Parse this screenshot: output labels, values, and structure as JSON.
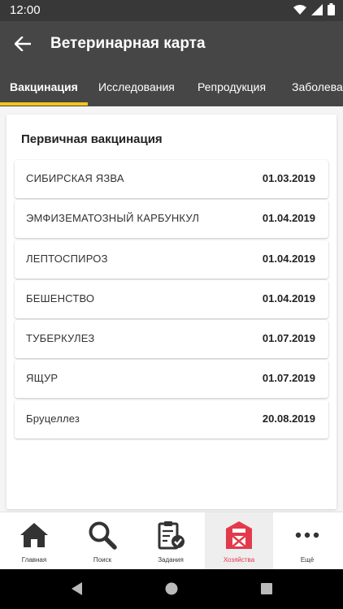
{
  "status_bar": {
    "time": "12:00"
  },
  "app_bar": {
    "title": "Ветеринарная карта"
  },
  "tabs": [
    {
      "label": "Вакцинация",
      "active": true
    },
    {
      "label": "Исследования",
      "active": false
    },
    {
      "label": "Репродукция",
      "active": false
    },
    {
      "label": "Заболева",
      "active": false
    }
  ],
  "section": {
    "title": "Первичная вакцинация",
    "rows": [
      {
        "name": "СИБИРСКАЯ ЯЗВА",
        "date": "01.03.2019"
      },
      {
        "name": "ЭМФИЗЕМАТОЗНЫЙ КАРБУНКУЛ",
        "date": "01.04.2019"
      },
      {
        "name": "ЛЕПТОСПИРОЗ",
        "date": "01.04.2019"
      },
      {
        "name": "БЕШЕНСТВО",
        "date": "01.04.2019"
      },
      {
        "name": "ТУБЕРКУЛЕЗ",
        "date": "01.07.2019"
      },
      {
        "name": "ЯЩУР",
        "date": "01.07.2019"
      },
      {
        "name": "Бруцеллез",
        "date": "20.08.2019"
      }
    ]
  },
  "bottom_nav": [
    {
      "label": "Главная",
      "icon": "home-icon",
      "active": false
    },
    {
      "label": "Поиск",
      "icon": "search-icon",
      "active": false
    },
    {
      "label": "Задания",
      "icon": "tasks-icon",
      "active": false
    },
    {
      "label": "Хозяйства",
      "icon": "barn-icon",
      "active": true
    },
    {
      "label": "Ещё",
      "icon": "more-icon",
      "active": false
    }
  ],
  "colors": {
    "bar": "#464646",
    "tab_indicator": "#f5c518",
    "active_nav": "#e33a4b"
  }
}
